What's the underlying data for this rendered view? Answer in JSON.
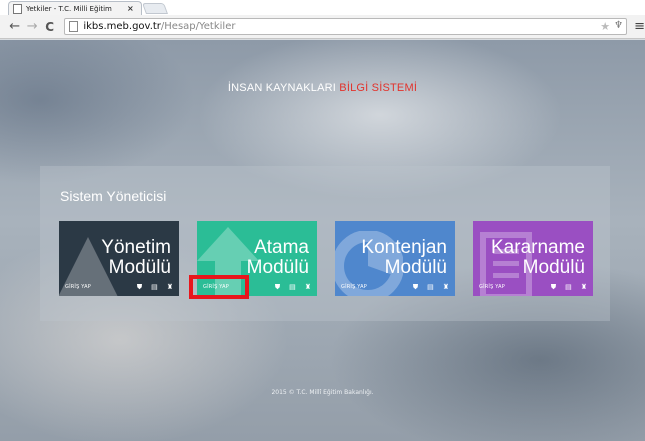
{
  "browser": {
    "tab_title": "Yetkiler - T.C. Milli Eğitim",
    "tab_close": "×",
    "url_host": "ikbs.meb.gov.tr",
    "url_path": "/Hesap/Yetkiler"
  },
  "page": {
    "headline_part1": "İNSAN KAYNAKLARI",
    "headline_part2": "BİLGİ SİSTEMİ",
    "headline_colors": {
      "part1": "#ffffff",
      "part2": "#e2332c"
    },
    "panel_title": "Sistem Yöneticisi",
    "modules": [
      {
        "title1": "Yönetim",
        "title2": "Modülü",
        "login": "GİRİŞ YAP",
        "color": "#2b3945"
      },
      {
        "title1": "Atama",
        "title2": "Modülü",
        "login": "GİRİŞ YAP",
        "color": "#2bbd96"
      },
      {
        "title1": "Kontenjan",
        "title2": "Modülü",
        "login": "GİRİŞ YAP",
        "color": "#4f87cd"
      },
      {
        "title1": "Kararname",
        "title2": "Modülü",
        "login": "GİRİŞ YAP",
        "color": "#9a4fc2"
      }
    ],
    "tile_icons": [
      "shield-icon",
      "document-icon",
      "users-icon"
    ],
    "highlight_color": "#e8161c",
    "footer": "2015 © T.C. Millî Eğitim Bakanlığı."
  }
}
